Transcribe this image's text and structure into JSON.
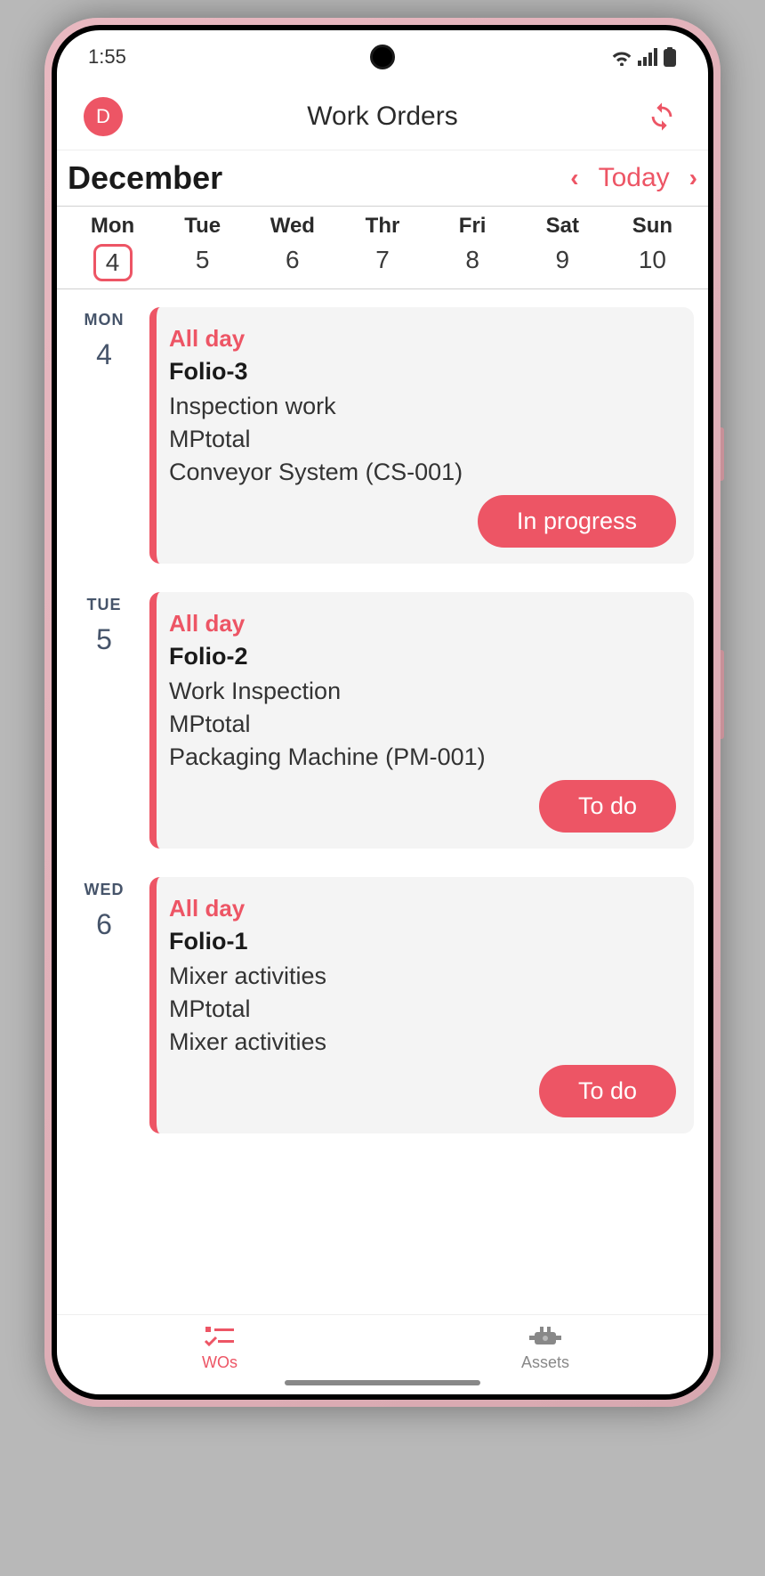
{
  "statusBar": {
    "time": "1:55"
  },
  "header": {
    "avatar": "D",
    "title": "Work Orders"
  },
  "monthBar": {
    "month": "December",
    "today": "Today"
  },
  "week": [
    {
      "name": "Mon",
      "num": "4",
      "selected": true
    },
    {
      "name": "Tue",
      "num": "5",
      "selected": false
    },
    {
      "name": "Wed",
      "num": "6",
      "selected": false
    },
    {
      "name": "Thr",
      "num": "7",
      "selected": false
    },
    {
      "name": "Fri",
      "num": "8",
      "selected": false
    },
    {
      "name": "Sat",
      "num": "9",
      "selected": false
    },
    {
      "name": "Sun",
      "num": "10",
      "selected": false
    }
  ],
  "entries": [
    {
      "dayShort": "MON",
      "dayNum": "4",
      "time": "All day",
      "title": "Folio-3",
      "line1": "Inspection work",
      "line2": "MPtotal",
      "line3": "Conveyor System (CS-001)",
      "status": "In progress"
    },
    {
      "dayShort": "TUE",
      "dayNum": "5",
      "time": "All day",
      "title": "Folio-2",
      "line1": "Work Inspection",
      "line2": "MPtotal",
      "line3": "Packaging Machine (PM-001)",
      "status": "To do"
    },
    {
      "dayShort": "WED",
      "dayNum": "6",
      "time": "All day",
      "title": "Folio-1",
      "line1": "Mixer activities",
      "line2": "MPtotal",
      "line3": "Mixer activities",
      "status": "To do"
    }
  ],
  "bottomNav": {
    "tab1": "WOs",
    "tab2": "Assets"
  }
}
